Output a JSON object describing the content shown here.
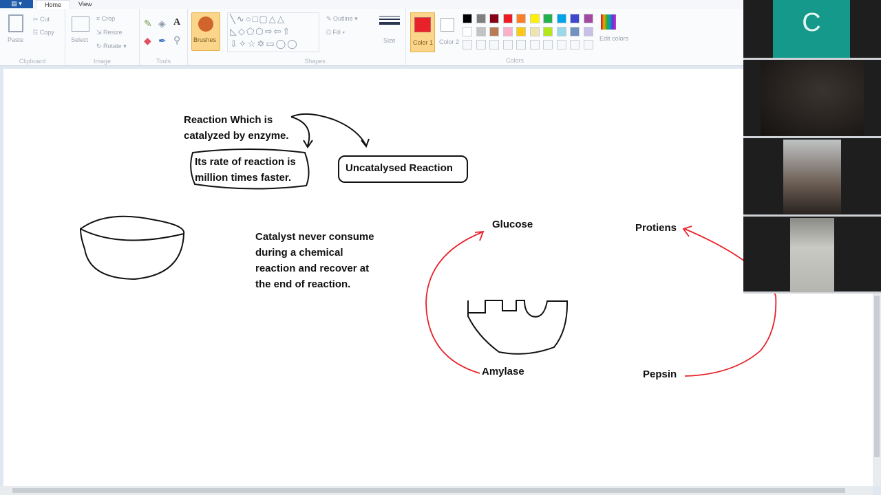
{
  "ribbon": {
    "tabs": [
      "Home",
      "View"
    ],
    "clipboard": {
      "paste": "Paste",
      "cut": "Cut",
      "copy": "Copy",
      "label": "Clipboard"
    },
    "image": {
      "select": "Select",
      "crop": "Crop",
      "resize": "Resize",
      "rotate": "Rotate",
      "label": "Image"
    },
    "tools": {
      "label": "Tools"
    },
    "brushes": "Brushes",
    "shapes": {
      "outline": "Outline",
      "fill": "Fill",
      "label": "Shapes"
    },
    "size": "Size",
    "colors": {
      "color1": "Color 1",
      "color2": "Color 2",
      "edit": "Edit colors",
      "label": "Colors",
      "color1_value": "#e8212a",
      "color2_value": "#ffffff",
      "palette_row1": [
        "#000000",
        "#7f7f7f",
        "#880015",
        "#ed1c24",
        "#ff7f27",
        "#fff200",
        "#22b14c",
        "#00a2e8",
        "#3f48cc",
        "#a349a4"
      ],
      "palette_row2": [
        "#ffffff",
        "#c3c3c3",
        "#b97a57",
        "#ffaec9",
        "#ffc90e",
        "#efe4b0",
        "#b5e61d",
        "#99d9ea",
        "#7092be",
        "#c8bfe7"
      ]
    }
  },
  "canvas": {
    "reaction_note": [
      "Reaction Which is",
      "catalyzed by enzyme."
    ],
    "rate_note": [
      "Its rate of reaction is",
      "million times faster."
    ],
    "uncatalysed": "Uncatalysed Reaction",
    "catalyst_note": [
      "Catalyst never consume",
      "during a chemical",
      "reaction and recover at",
      "the end of reaction."
    ],
    "glucose": "Glucose",
    "amylase": "Amylase",
    "protiens": "Protiens",
    "pepsin": "Pepsin"
  },
  "participants": [
    {
      "initial": "C",
      "color": "#14998a"
    }
  ]
}
